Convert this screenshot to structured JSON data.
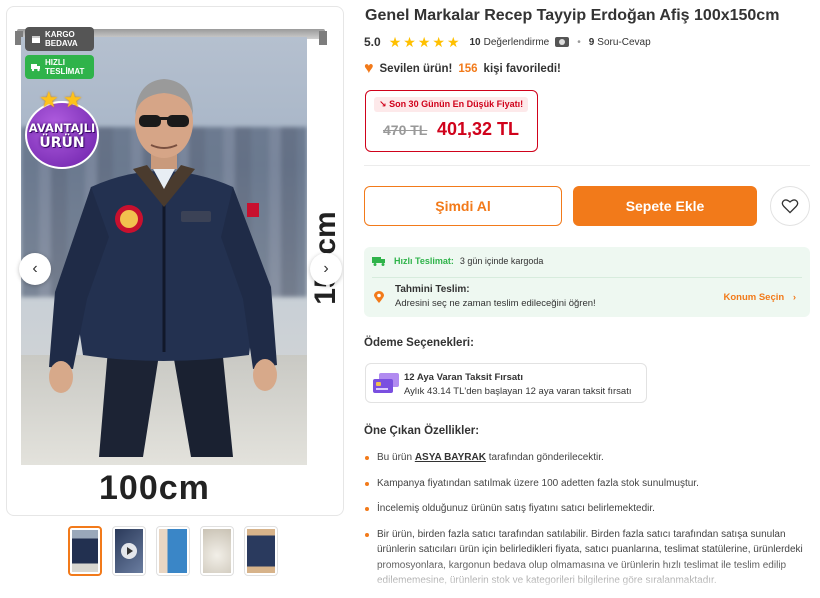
{
  "gallery": {
    "badges": {
      "kargo": "KARGO BEDAVA",
      "hizli": "HIZLI TESLİMAT"
    },
    "avantaj": {
      "line1": "AVANTAJLI",
      "line2": "ÜRÜN"
    },
    "poster_width_label": "100cm",
    "poster_height_label": "150cm",
    "prev_icon": "chevron-left-icon",
    "next_icon": "chevron-right-icon",
    "thumbnail_count": 5,
    "active_thumbnail": 1
  },
  "product": {
    "brand": "Genel Markalar",
    "name": "Recep Tayyip Erdoğan Afiş 100x150cm"
  },
  "rating": {
    "score": "5.0",
    "stars": 5,
    "review_count": "10",
    "review_label": "Değerlendirme",
    "qa_count": "9",
    "qa_label": "Soru-Cevap"
  },
  "favorite": {
    "prefix": "Sevilen ürün!",
    "count": "156",
    "suffix": "kişi favoriledi!"
  },
  "price": {
    "tag": "Son 30 Günün En Düşük Fiyatı!",
    "old": "470 TL",
    "new": "401,32 TL"
  },
  "actions": {
    "buy_now": "Şimdi Al",
    "add_to_cart": "Sepete Ekle",
    "favorite_icon": "heart-icon"
  },
  "delivery": {
    "fast_label": "Hızlı Teslimat:",
    "fast_text": "3 gün içinde kargoda",
    "estimate_title": "Tahmini Teslim:",
    "estimate_text": "Adresini seç ne zaman teslim edileceğini öğren!",
    "location_link": "Konum Seçin"
  },
  "payment": {
    "title": "Ödeme Seçenekleri:",
    "card_title": "12 Aya Varan Taksit Fırsatı",
    "card_text": "Aylık 43.14 TL'den başlayan 12 aya varan taksit fırsatı"
  },
  "features": {
    "title": "Öne Çıkan Özellikler:",
    "item1_prefix": "Bu ürün",
    "item1_seller": "ASYA BAYRAK",
    "item1_suffix": "tarafından gönderilecektir.",
    "item2": "Kampanya fiyatından satılmak üzere 100 adetten fazla stok sunulmuştur.",
    "item3": "İncelemiş olduğunuz ürünün satış fiyatını satıcı belirlemektedir.",
    "item4": "Bir ürün, birden fazla satıcı tarafından satılabilir. Birden fazla satıcı tarafından satışa sunulan ürünlerin satıcıları ürün için belirledikleri fiyata, satıcı puanlarına, teslimat statülerine, ürünlerdeki promosyonlara, kargonun bedava olup olmamasına ve ürünlerin hızlı teslimat ile teslim edilip edilememesine, ürünlerin stok ve kategorileri bilgilerine göre sıralanmaktadır."
  },
  "colors": {
    "brand_orange": "#f27a1a",
    "discount_red": "#d0021b",
    "fast_green": "#2fb34a",
    "star_yellow": "#ffc000",
    "badge_purple": "#6a1fa8"
  }
}
